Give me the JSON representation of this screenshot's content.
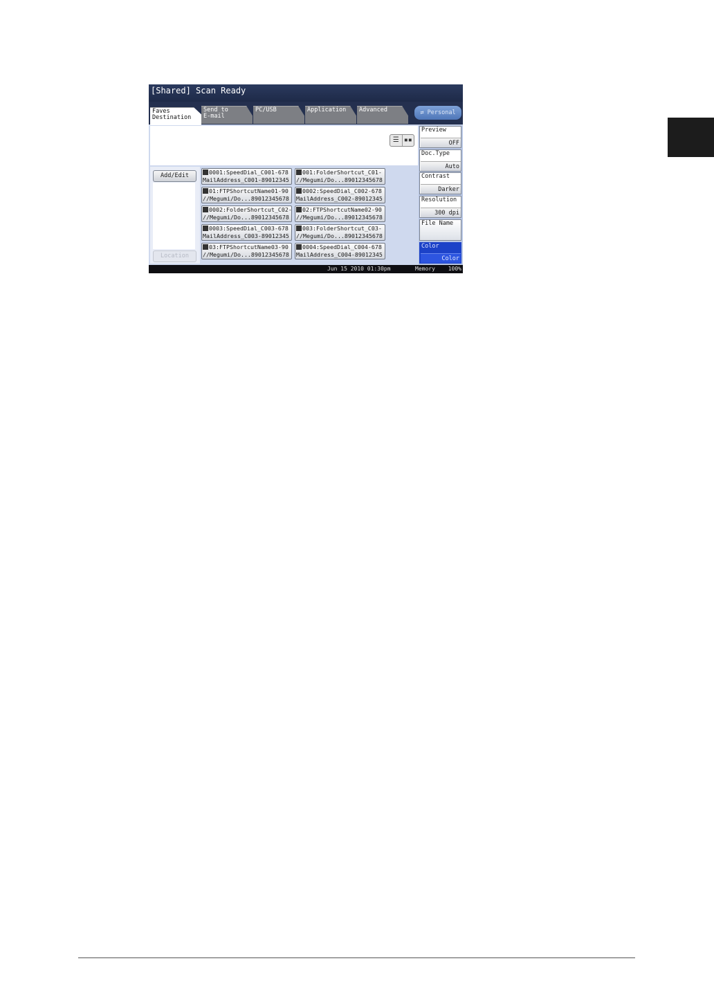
{
  "screen": {
    "title": "[Shared] Scan Ready",
    "tabs": [
      {
        "label_line1": "Faves",
        "label_line2": "Destination",
        "active": true
      },
      {
        "label_line1": "Send to",
        "label_line2": "E-mail",
        "active": false
      },
      {
        "label_line1": "PC/USB",
        "label_line2": "",
        "active": false
      },
      {
        "label_line1": "Application",
        "label_line2": "",
        "active": false
      },
      {
        "label_line1": "Advanced",
        "label_line2": "",
        "active": false
      }
    ],
    "personal_button": "Personal",
    "add_edit": "Add/Edit",
    "location": "Location",
    "entries": [
      {
        "line1": "0001:SpeedDial_C001-678",
        "line2": "MailAddress_C001-89012345",
        "icon": "email-icon"
      },
      {
        "line1": "001:FolderShortcut_C01-",
        "line2": "//Megumi/Do...89012345678",
        "icon": "folder-icon"
      },
      {
        "line1": "01:FTPShortcutName01-90",
        "line2": "//Megumi/Do...89012345678",
        "icon": "ftp-icon"
      },
      {
        "line1": "0002:SpeedDial_C002-678",
        "line2": "MailAddress_C002-89012345",
        "icon": "email-icon"
      },
      {
        "line1": "0002:FolderShortcut_C02-",
        "line2": "//Megumi/Do...89012345678",
        "icon": "folder-icon"
      },
      {
        "line1": "02:FTPShortcutName02-90",
        "line2": "//Megumi/Do...89012345678",
        "icon": "ftp-icon"
      },
      {
        "line1": "0003:SpeedDial_C003-678",
        "line2": "MailAddress_C003-89012345",
        "icon": "email-icon"
      },
      {
        "line1": "003:FolderShortcut_C03-",
        "line2": "//Megumi/Do...89012345678",
        "icon": "folder-icon"
      },
      {
        "line1": "03:FTPShortcutName03-90",
        "line2": "//Megumi/Do...89012345678",
        "icon": "ftp-icon"
      },
      {
        "line1": "0004:SpeedDial_C004-678",
        "line2": "MailAddress_C004-89012345",
        "icon": "email-icon"
      }
    ],
    "settings": [
      {
        "label": "Preview",
        "value": "OFF"
      },
      {
        "label": "Doc.Type",
        "value": "Auto"
      },
      {
        "label": "Contrast",
        "value": "Darker"
      },
      {
        "label": "Resolution",
        "value": "300 dpi"
      },
      {
        "label": "File Name",
        "value": ""
      },
      {
        "label": "Color",
        "value": "Color"
      }
    ],
    "status": {
      "datetime": "Jun 15 2010 01:30pm",
      "memory_label": "Memory",
      "memory_value": "100%"
    }
  },
  "colors": {
    "accent": "#1c42c8",
    "titlebar": "#24304f",
    "panel": "#cfd9ee"
  }
}
